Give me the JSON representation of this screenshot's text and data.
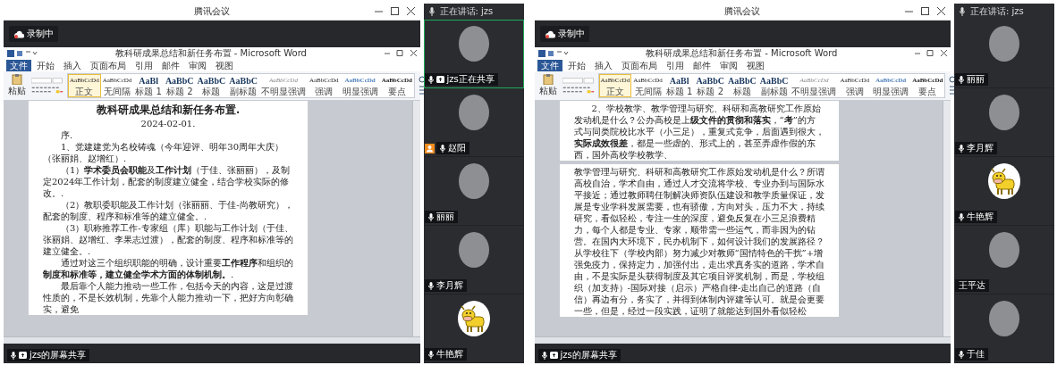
{
  "meetings": [
    {
      "title": "腾讯会议",
      "recording": "录制中",
      "share_label": "jzs的屏幕共享",
      "speaking": "正在讲话: jzs",
      "word": {
        "title": "教科研成果总结和新任务布置 - Microsoft Word",
        "tabs": [
          {
            "label": "文件",
            "selected": true
          },
          {
            "label": "开始",
            "selected": false
          },
          {
            "label": "插入",
            "selected": false
          },
          {
            "label": "页面布局",
            "selected": false
          },
          {
            "label": "引用",
            "selected": false
          },
          {
            "label": "邮件",
            "selected": false
          },
          {
            "label": "审阅",
            "selected": false
          },
          {
            "label": "视图",
            "selected": false
          }
        ],
        "paste": "粘贴",
        "styles": [
          {
            "sample": "AaBbCcDd",
            "label": "正文",
            "kind": "body",
            "selected": true
          },
          {
            "sample": "AaBbCcDd",
            "label": "无间隔",
            "kind": "body",
            "selected": false
          },
          {
            "sample": "AaBl",
            "label": "标题 1",
            "kind": "heading",
            "selected": false
          },
          {
            "sample": "AaBbC",
            "label": "标题 2",
            "kind": "heading",
            "selected": false
          },
          {
            "sample": "AaBbC",
            "label": "标题",
            "kind": "heading",
            "selected": false
          },
          {
            "sample": "AaBbC",
            "label": "副标题",
            "kind": "heading",
            "selected": false
          },
          {
            "sample": "AaBbCcDd",
            "label": "不明显强调",
            "kind": "subtle",
            "selected": false
          },
          {
            "sample": "AaBbCcDd",
            "label": "强调",
            "kind": "body",
            "selected": false
          },
          {
            "sample": "AaBbCcDd",
            "label": "明显强调",
            "kind": "emphasis",
            "selected": false
          },
          {
            "sample": "AaBbCcDd",
            "label": "要点",
            "kind": "strong",
            "selected": false
          }
        ],
        "pages": [
          {
            "paragraphs": [
              {
                "kind": "title",
                "text": "教科研成果总结和新任务布置."
              },
              {
                "kind": "date",
                "text": "2024-02-01."
              },
              {
                "kind": "body",
                "text": "序."
              },
              {
                "kind": "body",
                "text": "1、党建建党为名校铸魂（今年迎评、明年30周年大庆）（张丽娟、赵增红）."
              },
              {
                "kind": "body",
                "text": "（1）**学术委员会职能**及**工作计划**（于佳、张丽丽），及制定2024年工作计划，配套的制度建立健全，结合学校实际的修改。."
              },
              {
                "kind": "body",
                "text": "（2）教职委职能及工作计划（张丽丽、于佳-尚教研究），配套的制度、程序和标准等的建立健全。."
              },
              {
                "kind": "body",
                "text": "（3）职称推荐工作-专家组（库）职能与工作计划（于佳、张丽娟、赵增红、李果志过渡），配套的制度、程序和标准等的建立健全。."
              },
              {
                "kind": "body",
                "text": "通过对这三个组织职能的明确，设计重要**工作程序**和组织的**制度和标准等，建立健全学术方面的体制机制。**."
              },
              {
                "kind": "body",
                "text": "最后靠个人能力推动一些工作，包括今天的内容，这是过渡性质的，不是长效机制，先靠个人能力推动一下，把好方向彰确实，避免"
              }
            ]
          }
        ]
      },
      "participants": [
        {
          "name": "jzs正在共享",
          "kind": "photo",
          "highlighted": true,
          "host": false,
          "mic": true,
          "sharing": true
        },
        {
          "name": "赵阳",
          "kind": "photo",
          "highlighted": false,
          "host": true,
          "mic": true,
          "sharing": false
        },
        {
          "name": "丽丽",
          "kind": "photo",
          "highlighted": false,
          "host": false,
          "mic": true,
          "sharing": false
        },
        {
          "name": "李月辉",
          "kind": "photo",
          "highlighted": false,
          "host": false,
          "mic": true,
          "sharing": false
        },
        {
          "name": "牛艳辉",
          "kind": "cow",
          "highlighted": false,
          "host": false,
          "mic": true,
          "sharing": false
        }
      ]
    },
    {
      "title": "腾讯会议",
      "recording": "录制中",
      "share_label": "jzs的屏幕共享",
      "speaking": "正在讲话: jzs",
      "word": {
        "title": "教科研成果总结和新任务布置 - Microsoft Word",
        "tabs": [
          {
            "label": "文件",
            "selected": true
          },
          {
            "label": "开始",
            "selected": false
          },
          {
            "label": "插入",
            "selected": false
          },
          {
            "label": "页面布局",
            "selected": false
          },
          {
            "label": "引用",
            "selected": false
          },
          {
            "label": "邮件",
            "selected": false
          },
          {
            "label": "审阅",
            "selected": false
          },
          {
            "label": "视图",
            "selected": false
          }
        ],
        "paste": "粘贴",
        "styles": [
          {
            "sample": "AaBbCcDd",
            "label": "正文",
            "kind": "body",
            "selected": true
          },
          {
            "sample": "AaBbCcDd",
            "label": "无间隔",
            "kind": "body",
            "selected": false
          },
          {
            "sample": "AaBl",
            "label": "标题 1",
            "kind": "heading",
            "selected": false
          },
          {
            "sample": "AaBbC",
            "label": "标题 2",
            "kind": "heading",
            "selected": false
          },
          {
            "sample": "AaBbC",
            "label": "标题",
            "kind": "heading",
            "selected": false
          },
          {
            "sample": "AaBbC",
            "label": "副标题",
            "kind": "heading",
            "selected": false
          },
          {
            "sample": "AaBbCcDd",
            "label": "不明显强调",
            "kind": "subtle",
            "selected": false
          },
          {
            "sample": "AaBbCcDd",
            "label": "强调",
            "kind": "body",
            "selected": false
          },
          {
            "sample": "AaBbCcDd",
            "label": "明显强调",
            "kind": "emphasis",
            "selected": false
          },
          {
            "sample": "AaBbCcDd",
            "label": "要点",
            "kind": "strong",
            "selected": false
          }
        ],
        "pages": [
          {
            "paragraphs": [
              {
                "kind": "body",
                "text": "2、学校教学、教学管理与研究、科研和高教研究工作原始发动机是什么？公办高校是上**级文件的贯彻和落实**，“**考**”的方式与同类院校比水平（小三足），重复式竞争，后面遇到很大，**实际成效很差**，都是一些虚的、形式上的，甚至弄虚作假的东西，国外高校学校教学、"
              }
            ]
          },
          {
            "paragraphs": [
              {
                "kind": "plain",
                "text": "教学管理与研究、科研和高教研究工作原始发动机是什么？所谓高校自治，学术自由，通过人才交流将学校、专业办到与国际水平接近；通过教师聘任制解决师资队伍建设和教学质量保证，发展是专业学科发展需要，也有骄傲，方向对头，压力不大，持续研究，看似轻松，专注一生的深度，避免反复在小三足浪费精力，每个人都是专业、专家，顺带需一些运气，而非因为的钻营。在国内大环境下，民办机制下，如何设计我们的发展路径？从学校往下（学校内部）努力减少对教师“国情特色的干扰”+增强免疫力，保持定力，加强付出，走出求真务实的道路，学术自由，不是实际是头获得制度及其它项目评奖机制，而是，学校组织（加支持）-国际对接（启示）严格自律-走出自己的道路（自信）再边有分，务实了，并得到体制内评建等认可。就是会更要一些，但是，经过一段实践，证明了就能达到国外看似轻松"
              }
            ]
          }
        ]
      },
      "participants": [
        {
          "name": "丽丽",
          "kind": "photo",
          "highlighted": false,
          "host": false,
          "mic": true,
          "sharing": false
        },
        {
          "name": "李月辉",
          "kind": "photo",
          "highlighted": false,
          "host": false,
          "mic": true,
          "sharing": false
        },
        {
          "name": "牛艳辉",
          "kind": "cow",
          "highlighted": false,
          "host": false,
          "mic": true,
          "sharing": false
        },
        {
          "name": "王平达",
          "kind": "photo",
          "highlighted": false,
          "host": false,
          "mic": false,
          "sharing": false
        },
        {
          "name": "于佳",
          "kind": "photo",
          "highlighted": false,
          "host": false,
          "mic": true,
          "sharing": false
        }
      ]
    }
  ]
}
